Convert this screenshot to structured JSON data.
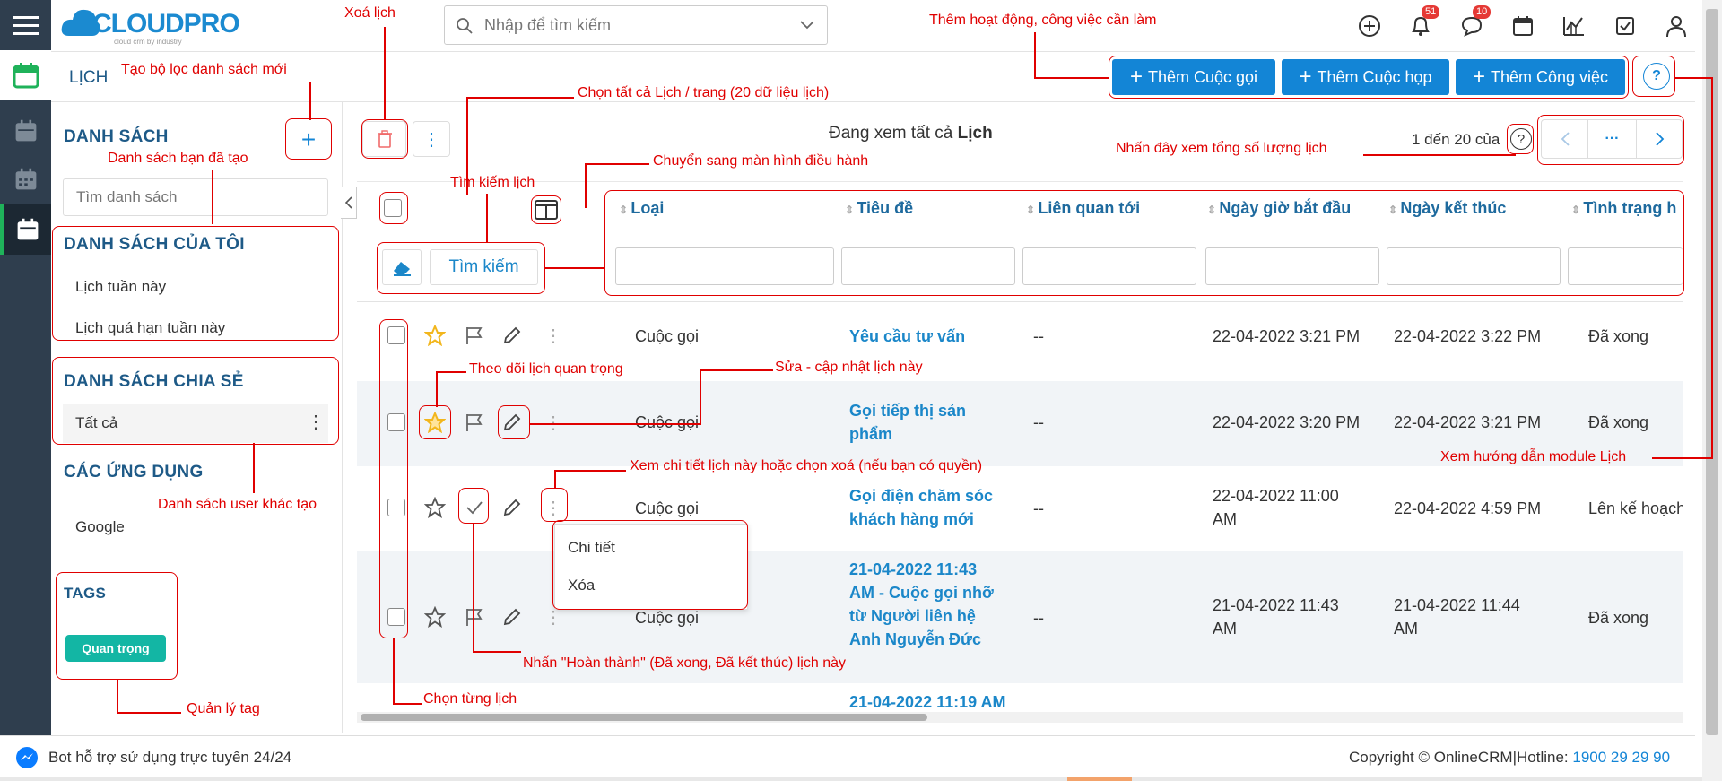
{
  "header": {
    "logo_text": "CLOUDPRO",
    "logo_tagline": "cloud crm by industry",
    "search_placeholder": "Nhập để tìm kiếm",
    "notifications_count": "51",
    "messages_count": "10"
  },
  "page": {
    "module_title": "LỊCH",
    "viewing_text": "Đang xem tất cả ",
    "viewing_bold": "Lịch",
    "pagination_text": "1 đến 20 của",
    "pagination_more": "···"
  },
  "actions": {
    "add_call": "Thêm Cuộc gọi",
    "add_meeting": "Thêm Cuộc họp",
    "add_task": "Thêm Công việc"
  },
  "sidebar": {
    "lists_title": "DANH SÁCH",
    "search_placeholder": "Tìm danh sách",
    "my_lists_title": "DANH SÁCH CỦA TÔI",
    "my_lists": [
      "Lịch tuần này",
      "Lịch quá hạn tuần này"
    ],
    "shared_title": "DANH SÁCH CHIA SẺ",
    "shared_lists": [
      "Tất cả"
    ],
    "apps_title": "CÁC ỨNG DỤNG",
    "apps": [
      "Google"
    ],
    "tags_title": "TAGS",
    "tags": [
      "Quan trọng"
    ]
  },
  "table": {
    "search_button": "Tìm kiếm",
    "columns": [
      "Loại",
      "Tiêu đề",
      "Liên quan tới",
      "Ngày giờ bắt đầu",
      "Ngày kết thúc",
      "Tình trạng h"
    ],
    "rows": [
      {
        "type": "Cuộc gọi",
        "title": "Yêu cầu tư vấn",
        "related": "--",
        "start": "22-04-2022 3:21 PM",
        "end": "22-04-2022 3:22 PM",
        "status": "Đã xong"
      },
      {
        "type": "Cuộc gọi",
        "title": "Gọi tiếp thị sản phẩm",
        "related": "--",
        "start": "22-04-2022 3:20 PM",
        "end": "22-04-2022 3:21 PM",
        "status": "Đã xong"
      },
      {
        "type": "Cuộc gọi",
        "title": "Gọi điện chăm sóc khách hàng mới",
        "related": "--",
        "start": "22-04-2022 11:00 AM",
        "end": "22-04-2022 4:59 PM",
        "status": "Lên kế hoạch"
      },
      {
        "type": "Cuộc gọi",
        "title": "21-04-2022 11:43 AM - Cuộc gọi nhỡ từ Người liên hệ Anh Nguyễn Đức",
        "related": "--",
        "start": "21-04-2022 11:43 AM",
        "end": "21-04-2022 11:44 AM",
        "status": "Đã xong"
      },
      {
        "type": "",
        "title": "21-04-2022 11:19 AM",
        "related": "",
        "start": "",
        "end": "",
        "status": ""
      }
    ],
    "row_menu": [
      "Chi tiết",
      "Xóa"
    ]
  },
  "footer": {
    "bot_text": "Bot hỗ trợ sử dụng trực tuyến 24/24",
    "copyright": "Copyright © OnlineCRM|Hotline: ",
    "hotline": "1900 29 29 90"
  },
  "annotations": {
    "delete": "Xoá lịch",
    "add_activity": "Thêm hoạt động, công việc cần làm",
    "new_filter": "Tạo bộ lọc danh sách mới",
    "select_all": "Chọn tất cả Lịch / trang (20 dữ liệu lịch)",
    "total_count": "Nhấn đây xem tổng số lượng lịch",
    "my_created": "Danh sách bạn đã tạo",
    "search_cal": "Tìm kiếm lịch",
    "switch_screen": "Chuyển sang màn hình điều hành",
    "follow": "Theo dõi lịch quan trọng",
    "edit": "Sửa - cập nhật lịch này",
    "view_detail": "Xem chi tiết lịch này hoặc chọn xoá (nếu bạn có quyền)",
    "guide": "Xem hướng dẫn module Lịch",
    "others_created": "Danh sách user khác tạo",
    "complete": "Nhấn \"Hoàn thành\" (Đã xong, Đã kết thúc)  lịch này",
    "select_one": "Chọn từng lịch",
    "manage_tag": "Quản lý tag"
  },
  "colors": {
    "rail": "#2f3e4e",
    "primary": "#1385d6",
    "annotation": "#e00000",
    "tag": "#13b6a4",
    "active_rail": "#1fb25a"
  }
}
